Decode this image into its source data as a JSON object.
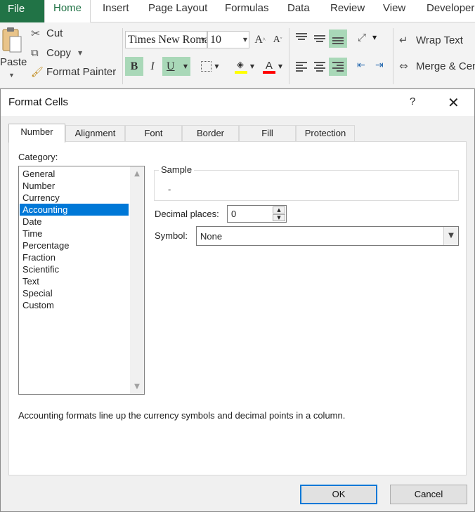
{
  "ribbon": {
    "file_tab": "File",
    "tabs": [
      "Home",
      "Insert",
      "Page Layout",
      "Formulas",
      "Data",
      "Review",
      "View",
      "Developer"
    ],
    "clipboard": {
      "paste": "Paste",
      "cut": "Cut",
      "copy": "Copy",
      "format_painter": "Format Painter"
    },
    "font": {
      "name": "Times New Roman",
      "size": "10",
      "grow": "A",
      "shrink": "A",
      "bold": "B",
      "italic": "I",
      "underline": "U",
      "font_color_letter": "A",
      "fill_color": "#ffff00",
      "font_color": "#ff0000"
    },
    "alignment": {
      "wrap_text": "Wrap Text",
      "merge": "Merge & Center"
    },
    "accent_color": "#217346",
    "active_button_color": "#a9d8b8"
  },
  "dialog": {
    "title": "Format Cells",
    "help": "?",
    "close": "✕",
    "tabs": [
      "Number",
      "Alignment",
      "Font",
      "Border",
      "Fill",
      "Protection"
    ],
    "active_tab": "Number",
    "category_label": "Category:",
    "categories": [
      "General",
      "Number",
      "Currency",
      "Accounting",
      "Date",
      "Time",
      "Percentage",
      "Fraction",
      "Scientific",
      "Text",
      "Special",
      "Custom"
    ],
    "selected_category": "Accounting",
    "sample_label": "Sample",
    "sample_value": "-",
    "decimal_places_label": "Decimal places:",
    "decimal_places_value": "0",
    "symbol_label": "Symbol:",
    "symbol_value": "None",
    "description": "Accounting formats line up the currency symbols and decimal points in a column.",
    "ok": "OK",
    "cancel": "Cancel",
    "selection_color": "#0078d7"
  }
}
